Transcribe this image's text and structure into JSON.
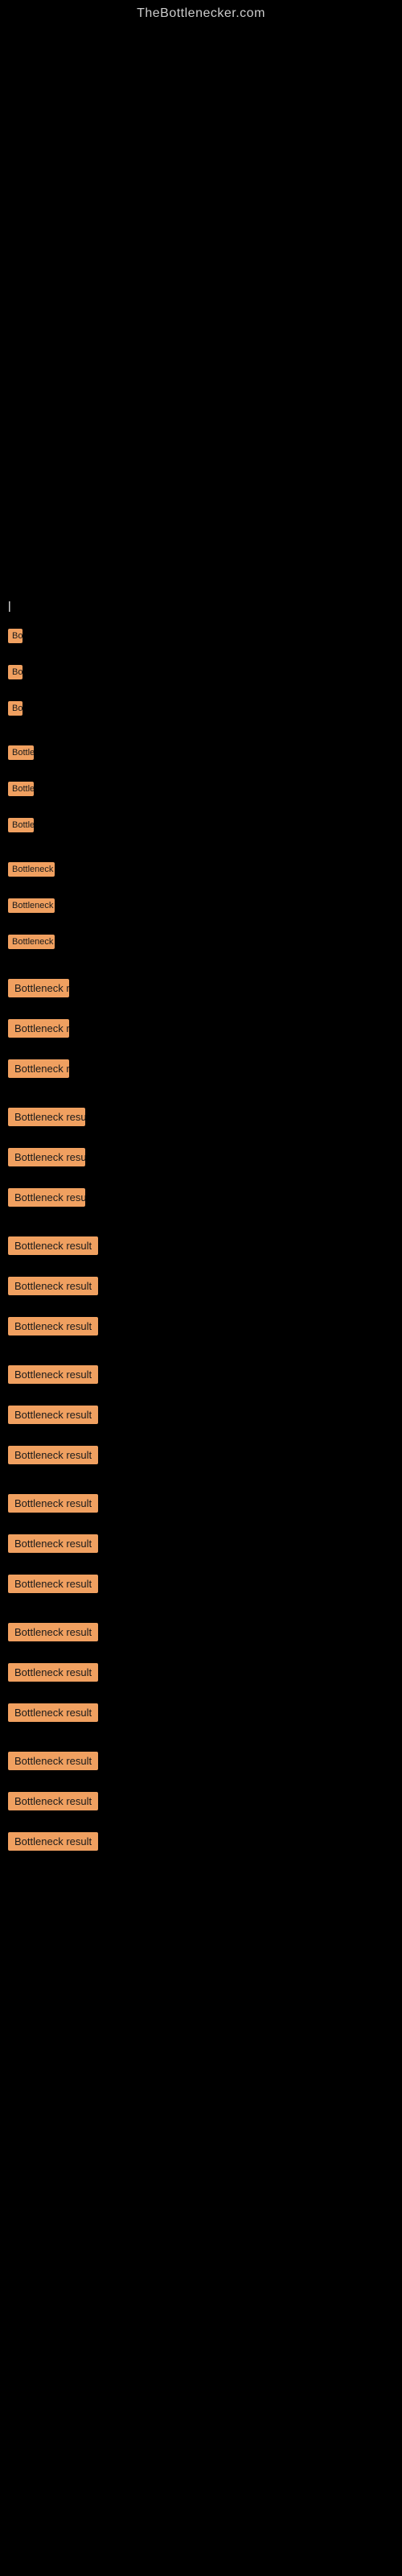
{
  "site": {
    "title": "TheBottlenecker.com"
  },
  "items": [
    {
      "id": 1,
      "label": "Bottleneck result",
      "size": "xs"
    },
    {
      "id": 2,
      "label": "Bottleneck result",
      "size": "xs"
    },
    {
      "id": 3,
      "label": "Bottleneck result",
      "size": "xs"
    },
    {
      "id": 4,
      "label": "Bottleneck result",
      "size": "sm"
    },
    {
      "id": 5,
      "label": "Bottleneck result",
      "size": "sm"
    },
    {
      "id": 6,
      "label": "Bottleneck result",
      "size": "sm"
    },
    {
      "id": 7,
      "label": "Bottleneck result",
      "size": "md"
    },
    {
      "id": 8,
      "label": "Bottleneck result",
      "size": "md"
    },
    {
      "id": 9,
      "label": "Bottleneck result",
      "size": "md"
    },
    {
      "id": 10,
      "label": "Bottleneck result",
      "size": "lg"
    },
    {
      "id": 11,
      "label": "Bottleneck result",
      "size": "lg"
    },
    {
      "id": 12,
      "label": "Bottleneck result",
      "size": "lg"
    },
    {
      "id": 13,
      "label": "Bottleneck result",
      "size": "xl"
    },
    {
      "id": 14,
      "label": "Bottleneck result",
      "size": "xl"
    },
    {
      "id": 15,
      "label": "Bottleneck result",
      "size": "xl"
    },
    {
      "id": 16,
      "label": "Bottleneck result",
      "size": "xxl"
    },
    {
      "id": 17,
      "label": "Bottleneck result",
      "size": "xxl"
    },
    {
      "id": 18,
      "label": "Bottleneck result",
      "size": "xxl"
    },
    {
      "id": 19,
      "label": "Bottleneck result",
      "size": "full"
    },
    {
      "id": 20,
      "label": "Bottleneck result",
      "size": "full"
    },
    {
      "id": 21,
      "label": "Bottleneck result",
      "size": "full"
    },
    {
      "id": 22,
      "label": "Bottleneck result",
      "size": "full"
    },
    {
      "id": 23,
      "label": "Bottleneck result",
      "size": "full"
    },
    {
      "id": 24,
      "label": "Bottleneck result",
      "size": "full"
    },
    {
      "id": 25,
      "label": "Bottleneck result",
      "size": "full"
    },
    {
      "id": 26,
      "label": "Bottleneck result",
      "size": "full"
    },
    {
      "id": 27,
      "label": "Bottleneck result",
      "size": "full"
    },
    {
      "id": 28,
      "label": "Bottleneck result",
      "size": "full"
    },
    {
      "id": 29,
      "label": "Bottleneck result",
      "size": "full"
    },
    {
      "id": 30,
      "label": "Bottleneck result",
      "size": "full"
    }
  ],
  "sizeMap": {
    "xs": 18,
    "sm": 32,
    "md": 58,
    "lg": 76,
    "xl": 96,
    "xxl": 118,
    "full": 140
  }
}
